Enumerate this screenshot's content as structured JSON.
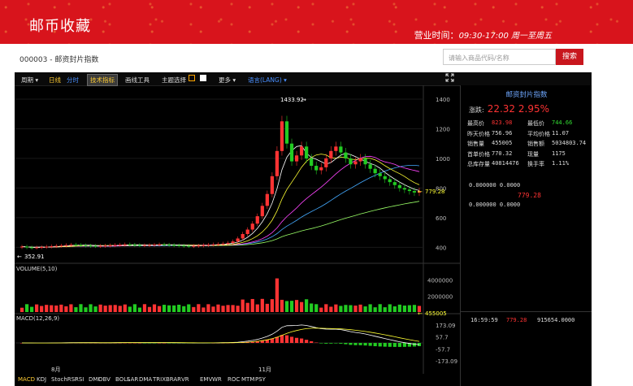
{
  "header": {
    "brand": "邮币收藏",
    "hours_label": "营业时间：",
    "hours_value": "09:30-17:00 周一至周五"
  },
  "product": {
    "code_name": "000003 - 邮资封片指数"
  },
  "search": {
    "placeholder": "请输入商品代码/名称",
    "button_label": "搜索"
  },
  "toolbar": {
    "period": "周期 ▾",
    "daily": "日线",
    "minute": "分时",
    "tech": "技术指标",
    "draw": "画线工具",
    "theme": "主题选择",
    "more": "更多 ▾",
    "lang": "语言(LANG) ▾",
    "fullscreen_icon": "expand-icon"
  },
  "info_panel": {
    "title": "邮资封片指数",
    "change_label": "涨跌:",
    "change_value": "22.32 2.95%",
    "rows": [
      {
        "l1": "最高价",
        "v1": "823.98",
        "c1": "red",
        "l2": "最低价",
        "v2": "744.66",
        "c2": "green"
      },
      {
        "l1": "昨天价格",
        "v1": "756.96",
        "c1": "",
        "l2": "平均价格",
        "v2": "11.07",
        "c2": ""
      },
      {
        "l1": "销售量",
        "v1": "455005",
        "c1": "",
        "l2": "销售额",
        "v2": "5034803.74",
        "c2": ""
      },
      {
        "l1": "首单价格",
        "v1": "770.32",
        "c1": "",
        "l2": "现量",
        "v2": "1175",
        "c2": ""
      },
      {
        "l1": "总库存量",
        "v1": "40814476",
        "c1": "",
        "l2": "换手率",
        "v2": "1.11%",
        "c2": ""
      }
    ],
    "book1": "0.000000    0.0000",
    "book_price": "779.28",
    "book2": "0.000000    0.0000",
    "trade_time": "16:59:59",
    "trade_price": "779.28",
    "trade_amount": "915654.0000"
  },
  "price_chart": {
    "y_ticks": [
      "1400",
      "1200",
      "1000",
      "800",
      "600",
      "400"
    ],
    "high_label": "1433.92",
    "low_label": "352.91",
    "last_label": "779.28"
  },
  "volume_chart": {
    "label": "VOLUME(5,10)",
    "y_ticks": [
      "4000000",
      "2000000"
    ],
    "last_label": "455005"
  },
  "macd_chart": {
    "label": "MACD(12,26,9)",
    "y_ticks": [
      "173.09",
      "57.7",
      "-57.7",
      "-173.09"
    ]
  },
  "x_axis": [
    "8月",
    "11月"
  ],
  "indicators": [
    "MACD",
    "KDJ",
    "StochRSI",
    "RSI",
    "DMI",
    "OBV",
    "BOLL",
    "SAR",
    "DMA",
    "TRIX",
    "BRAR",
    "VR",
    "EMV",
    "WR",
    "ROC",
    "MTM",
    "PSY"
  ],
  "colors": {
    "up": "#ff3333",
    "down": "#22cc22",
    "ma5": "#ffffff",
    "ma10": "#ffff33",
    "ma20": "#ff44ff",
    "ma30": "#44aaff",
    "ma60": "#99ff66",
    "accent": "#d8141c"
  },
  "chart_data": {
    "type": "candlestick",
    "y_range": [
      352.91,
      1433.92
    ],
    "close_series_approx": [
      405,
      400,
      398,
      400,
      402,
      405,
      408,
      410,
      412,
      415,
      418,
      416,
      414,
      412,
      410,
      408,
      410,
      412,
      414,
      416,
      418,
      420,
      418,
      416,
      414,
      415,
      416,
      418,
      420,
      418,
      416,
      414,
      412,
      410,
      408,
      410,
      412,
      415,
      418,
      420,
      422,
      425,
      430,
      440,
      460,
      490,
      520,
      560,
      610,
      680,
      760,
      880,
      1050,
      1250,
      1100,
      980,
      1020,
      1080,
      1000,
      950,
      920,
      940,
      1000,
      1050,
      1080,
      1040,
      1000,
      960,
      980,
      1000,
      960,
      930,
      900,
      880,
      860,
      840,
      820,
      800,
      790,
      780,
      770,
      779.28
    ],
    "last": 779.28,
    "high": 1433.92,
    "low": 352.91
  }
}
